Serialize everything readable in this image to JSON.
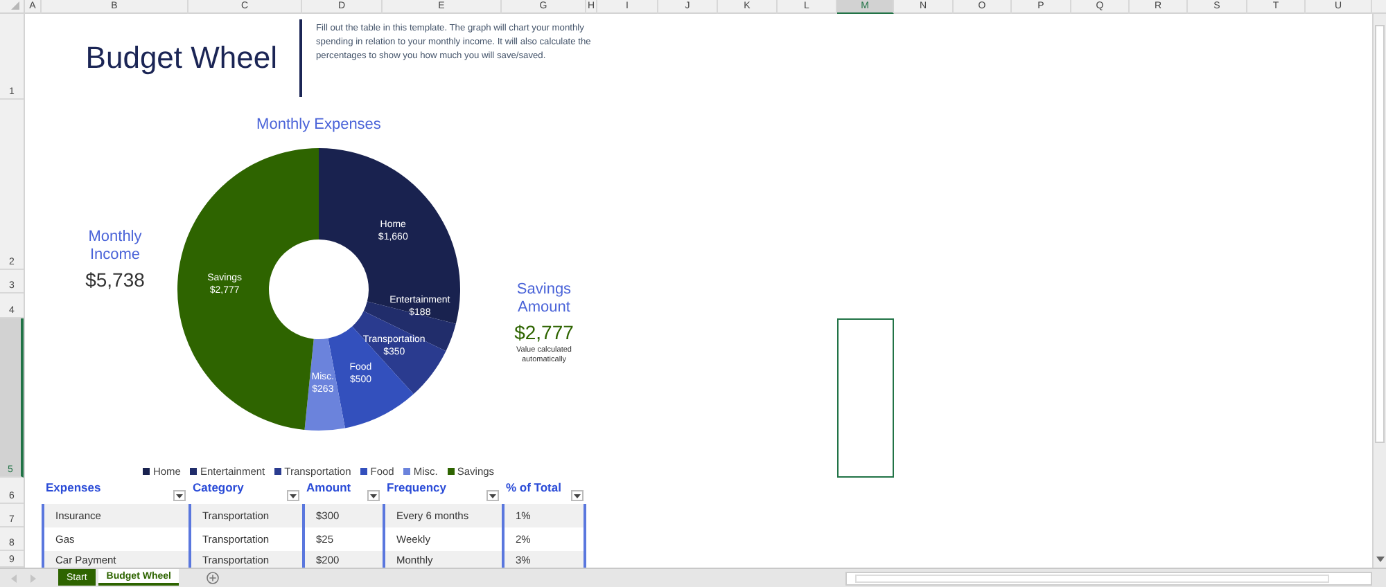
{
  "column_headers": [
    {
      "label": "A",
      "selected": false
    },
    {
      "label": "B",
      "selected": false
    },
    {
      "label": "C",
      "selected": false
    },
    {
      "label": "D",
      "selected": false
    },
    {
      "label": "E",
      "selected": false
    },
    {
      "label": "G",
      "selected": false
    },
    {
      "label": "H",
      "selected": false
    },
    {
      "label": "I",
      "selected": false
    },
    {
      "label": "J",
      "selected": false
    },
    {
      "label": "K",
      "selected": false
    },
    {
      "label": "L",
      "selected": false
    },
    {
      "label": "M",
      "selected": true
    },
    {
      "label": "N",
      "selected": false
    },
    {
      "label": "O",
      "selected": false
    },
    {
      "label": "P",
      "selected": false
    },
    {
      "label": "Q",
      "selected": false
    },
    {
      "label": "R",
      "selected": false
    },
    {
      "label": "S",
      "selected": false
    },
    {
      "label": "T",
      "selected": false
    },
    {
      "label": "U",
      "selected": false
    }
  ],
  "row_headers": [
    {
      "label": "1",
      "selected": false
    },
    {
      "label": "2",
      "selected": false
    },
    {
      "label": "3",
      "selected": false
    },
    {
      "label": "4",
      "selected": false
    },
    {
      "label": "5",
      "selected": true
    },
    {
      "label": "6",
      "selected": false
    },
    {
      "label": "7",
      "selected": false
    },
    {
      "label": "8",
      "selected": false
    },
    {
      "label": "9",
      "selected": false
    }
  ],
  "title": "Budget Wheel",
  "description": "Fill out the table in this template. The graph will chart your monthly spending in relation to your monthly income. It will also calculate the percentages to show you how much you will save/saved.",
  "monthly_income": {
    "label": "Monthly Income",
    "value": "$5,738"
  },
  "savings_amount": {
    "label": "Savings Amount",
    "value": "$2,777",
    "note": "Value calculated automatically"
  },
  "chart": {
    "chart_data": {
      "type": "donut",
      "title": "Monthly Expenses",
      "categories": [
        "Home",
        "Entertainment",
        "Transportation",
        "Food",
        "Misc.",
        "Savings"
      ],
      "values": [
        1660,
        188,
        350,
        500,
        263,
        2777
      ],
      "data_labels": true,
      "value_labels": [
        "$1,660",
        "$188",
        "$350",
        "$500",
        "$263",
        "$2,777"
      ]
    },
    "legend": [
      {
        "label": "Home",
        "color": "#19224f"
      },
      {
        "label": "Entertainment",
        "color": "#212d6b"
      },
      {
        "label": "Transportation",
        "color": "#2a3b8f"
      },
      {
        "label": "Food",
        "color": "#3350bd"
      },
      {
        "label": "Misc.",
        "color": "#6b83dc"
      },
      {
        "label": "Savings",
        "color": "#2e6400"
      }
    ]
  },
  "table": {
    "columns": [
      "Expenses",
      "Category",
      "Amount",
      "Frequency",
      "% of Total"
    ],
    "rows": [
      [
        "Insurance",
        "Transportation",
        "$300",
        "Every 6 months",
        "1%"
      ],
      [
        "Gas",
        "Transportation",
        "$25",
        "Weekly",
        "2%"
      ],
      [
        "Car Payment",
        "Transportation",
        "$200",
        "Monthly",
        "3%"
      ]
    ]
  },
  "sheet_tabs": [
    {
      "label": "Start",
      "selected": false
    },
    {
      "label": "Budget Wheel",
      "selected": true
    }
  ]
}
